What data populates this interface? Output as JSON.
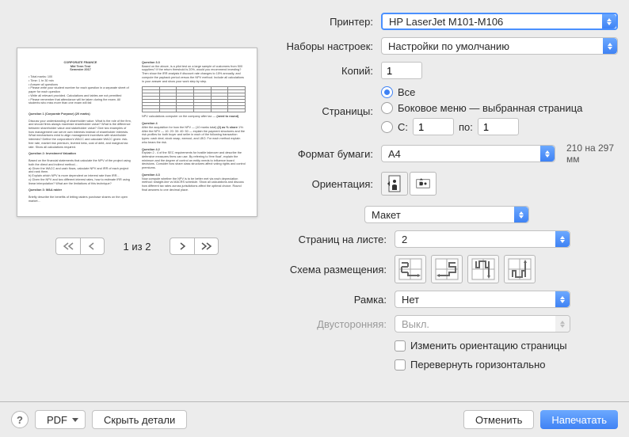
{
  "labels": {
    "printer": "Принтер:",
    "presets": "Наборы настроек:",
    "copies": "Копий:",
    "pages": "Страницы:",
    "all": "Все",
    "sidebar": "Боковое меню — выбранная страница",
    "from": "С:",
    "to": "по:",
    "paper": "Формат бумаги:",
    "orientation": "Ориентация:",
    "section": "Макет",
    "pages_per_sheet": "Страниц на листе:",
    "layout_direction": "Схема размещения:",
    "border": "Рамка:",
    "two_sided": "Двусторонняя:",
    "reverse_orientation": "Изменить ориентацию страницы",
    "flip_horizontal": "Перевернуть горизонтально",
    "pdf": "PDF",
    "hide_details": "Скрыть детали",
    "cancel": "Отменить",
    "print": "Напечатать",
    "help": "?"
  },
  "values": {
    "printer": "HP LaserJet M101-M106",
    "preset": "Настройки по умолчанию",
    "copies": "1",
    "from": "1",
    "to": "1",
    "paper": "A4",
    "paper_hint": "210 на 297 мм",
    "pages_per_sheet": "2",
    "border": "Нет",
    "two_sided": "Выкл."
  },
  "pager": "1 из 2"
}
